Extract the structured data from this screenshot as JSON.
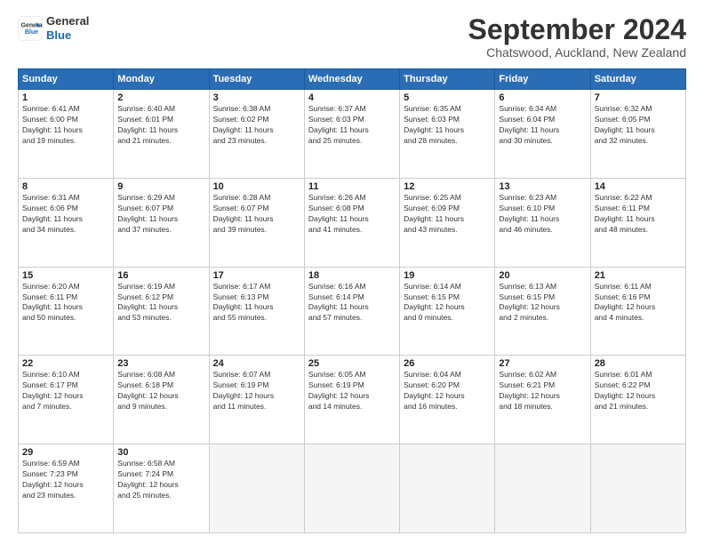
{
  "logo": {
    "line1": "General",
    "line2": "Blue"
  },
  "title": "September 2024",
  "subtitle": "Chatswood, Auckland, New Zealand",
  "days_of_week": [
    "Sunday",
    "Monday",
    "Tuesday",
    "Wednesday",
    "Thursday",
    "Friday",
    "Saturday"
  ],
  "weeks": [
    [
      {
        "day": "1",
        "info": "Sunrise: 6:41 AM\nSunset: 6:00 PM\nDaylight: 11 hours\nand 19 minutes."
      },
      {
        "day": "2",
        "info": "Sunrise: 6:40 AM\nSunset: 6:01 PM\nDaylight: 11 hours\nand 21 minutes."
      },
      {
        "day": "3",
        "info": "Sunrise: 6:38 AM\nSunset: 6:02 PM\nDaylight: 11 hours\nand 23 minutes."
      },
      {
        "day": "4",
        "info": "Sunrise: 6:37 AM\nSunset: 6:03 PM\nDaylight: 11 hours\nand 25 minutes."
      },
      {
        "day": "5",
        "info": "Sunrise: 6:35 AM\nSunset: 6:03 PM\nDaylight: 11 hours\nand 28 minutes."
      },
      {
        "day": "6",
        "info": "Sunrise: 6:34 AM\nSunset: 6:04 PM\nDaylight: 11 hours\nand 30 minutes."
      },
      {
        "day": "7",
        "info": "Sunrise: 6:32 AM\nSunset: 6:05 PM\nDaylight: 11 hours\nand 32 minutes."
      }
    ],
    [
      {
        "day": "8",
        "info": "Sunrise: 6:31 AM\nSunset: 6:06 PM\nDaylight: 11 hours\nand 34 minutes."
      },
      {
        "day": "9",
        "info": "Sunrise: 6:29 AM\nSunset: 6:07 PM\nDaylight: 11 hours\nand 37 minutes."
      },
      {
        "day": "10",
        "info": "Sunrise: 6:28 AM\nSunset: 6:07 PM\nDaylight: 11 hours\nand 39 minutes."
      },
      {
        "day": "11",
        "info": "Sunrise: 6:26 AM\nSunset: 6:08 PM\nDaylight: 11 hours\nand 41 minutes."
      },
      {
        "day": "12",
        "info": "Sunrise: 6:25 AM\nSunset: 6:09 PM\nDaylight: 11 hours\nand 43 minutes."
      },
      {
        "day": "13",
        "info": "Sunrise: 6:23 AM\nSunset: 6:10 PM\nDaylight: 11 hours\nand 46 minutes."
      },
      {
        "day": "14",
        "info": "Sunrise: 6:22 AM\nSunset: 6:11 PM\nDaylight: 11 hours\nand 48 minutes."
      }
    ],
    [
      {
        "day": "15",
        "info": "Sunrise: 6:20 AM\nSunset: 6:11 PM\nDaylight: 11 hours\nand 50 minutes."
      },
      {
        "day": "16",
        "info": "Sunrise: 6:19 AM\nSunset: 6:12 PM\nDaylight: 11 hours\nand 53 minutes."
      },
      {
        "day": "17",
        "info": "Sunrise: 6:17 AM\nSunset: 6:13 PM\nDaylight: 11 hours\nand 55 minutes."
      },
      {
        "day": "18",
        "info": "Sunrise: 6:16 AM\nSunset: 6:14 PM\nDaylight: 11 hours\nand 57 minutes."
      },
      {
        "day": "19",
        "info": "Sunrise: 6:14 AM\nSunset: 6:15 PM\nDaylight: 12 hours\nand 0 minutes."
      },
      {
        "day": "20",
        "info": "Sunrise: 6:13 AM\nSunset: 6:15 PM\nDaylight: 12 hours\nand 2 minutes."
      },
      {
        "day": "21",
        "info": "Sunrise: 6:11 AM\nSunset: 6:16 PM\nDaylight: 12 hours\nand 4 minutes."
      }
    ],
    [
      {
        "day": "22",
        "info": "Sunrise: 6:10 AM\nSunset: 6:17 PM\nDaylight: 12 hours\nand 7 minutes."
      },
      {
        "day": "23",
        "info": "Sunrise: 6:08 AM\nSunset: 6:18 PM\nDaylight: 12 hours\nand 9 minutes."
      },
      {
        "day": "24",
        "info": "Sunrise: 6:07 AM\nSunset: 6:19 PM\nDaylight: 12 hours\nand 11 minutes."
      },
      {
        "day": "25",
        "info": "Sunrise: 6:05 AM\nSunset: 6:19 PM\nDaylight: 12 hours\nand 14 minutes."
      },
      {
        "day": "26",
        "info": "Sunrise: 6:04 AM\nSunset: 6:20 PM\nDaylight: 12 hours\nand 16 minutes."
      },
      {
        "day": "27",
        "info": "Sunrise: 6:02 AM\nSunset: 6:21 PM\nDaylight: 12 hours\nand 18 minutes."
      },
      {
        "day": "28",
        "info": "Sunrise: 6:01 AM\nSunset: 6:22 PM\nDaylight: 12 hours\nand 21 minutes."
      }
    ],
    [
      {
        "day": "29",
        "info": "Sunrise: 6:59 AM\nSunset: 7:23 PM\nDaylight: 12 hours\nand 23 minutes."
      },
      {
        "day": "30",
        "info": "Sunrise: 6:58 AM\nSunset: 7:24 PM\nDaylight: 12 hours\nand 25 minutes."
      },
      {
        "day": "",
        "info": ""
      },
      {
        "day": "",
        "info": ""
      },
      {
        "day": "",
        "info": ""
      },
      {
        "day": "",
        "info": ""
      },
      {
        "day": "",
        "info": ""
      }
    ]
  ]
}
